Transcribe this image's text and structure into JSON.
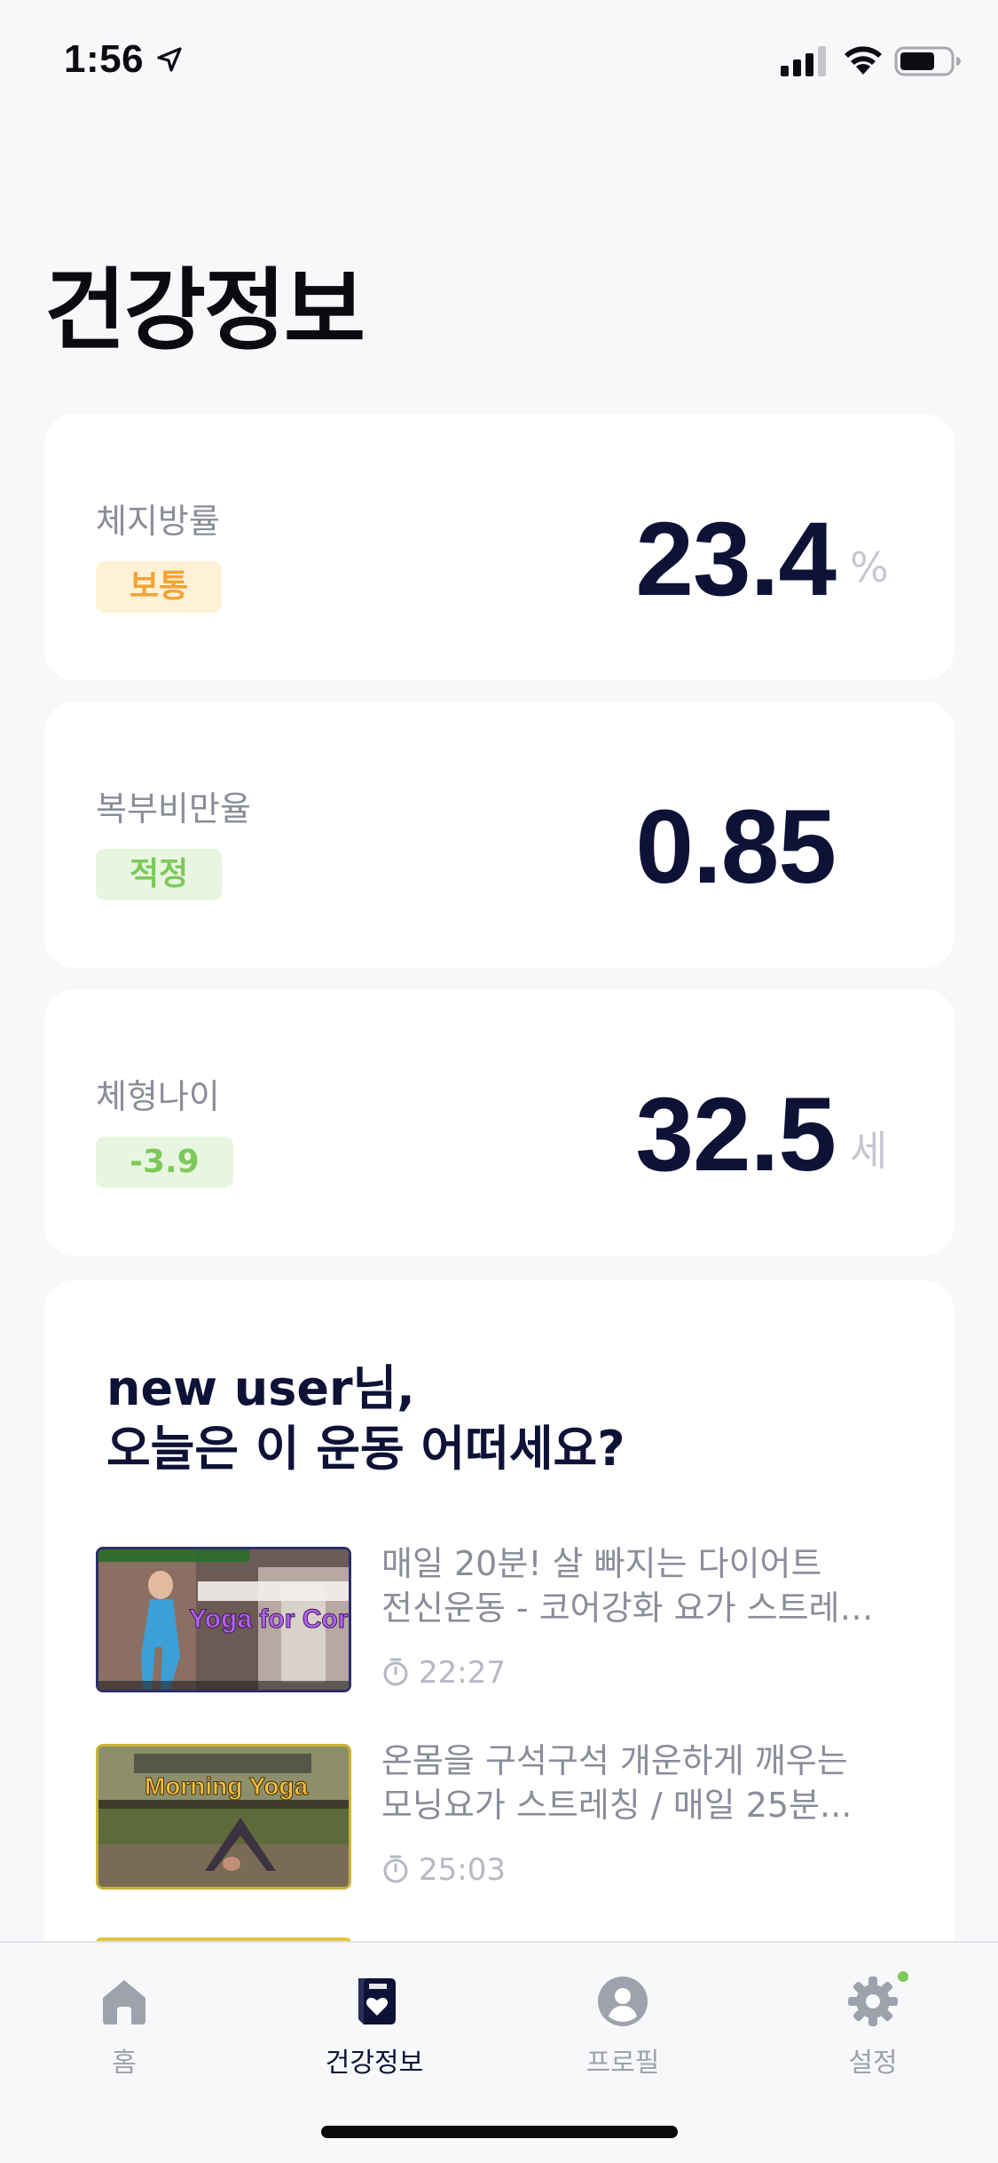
{
  "status_bar": {
    "time": "1:56"
  },
  "page": {
    "title": "건강정보"
  },
  "metrics": [
    {
      "label": "체지방률",
      "badge": "보통",
      "value": "23.4",
      "unit": "%"
    },
    {
      "label": "복부비만율",
      "badge": "적정",
      "value": "0.85",
      "unit": ""
    },
    {
      "label": "체형나이",
      "badge": "-3.9",
      "value": "32.5",
      "unit": "세"
    }
  ],
  "recommendation": {
    "title_line1": "new user님,",
    "title_line2": "오늘은 이 운동 어떠세요?",
    "videos": [
      {
        "title": "매일 20분! 살 빠지는 다이어트\n전신운동 - 코어강화 요가 스트레…",
        "duration": "22:27",
        "thumb_text": "Yoga for Core"
      },
      {
        "title": "온몸을 구석구석 개운하게 깨우는\n모닝요가 스트레칭 / 매일 25분...",
        "duration": "25:03",
        "thumb_text": "Morning Yoga"
      }
    ]
  },
  "tabs": [
    {
      "label": "홈",
      "icon": "home-icon",
      "active": false
    },
    {
      "label": "건강정보",
      "icon": "health-info-icon",
      "active": true
    },
    {
      "label": "프로필",
      "icon": "profile-icon",
      "active": false
    },
    {
      "label": "설정",
      "icon": "settings-icon",
      "active": false
    }
  ],
  "colors": {
    "accent": "#0E1236",
    "badge_orange": "#F1A333",
    "badge_green": "#7DC95A",
    "notification_dot": "#7DC95A"
  }
}
